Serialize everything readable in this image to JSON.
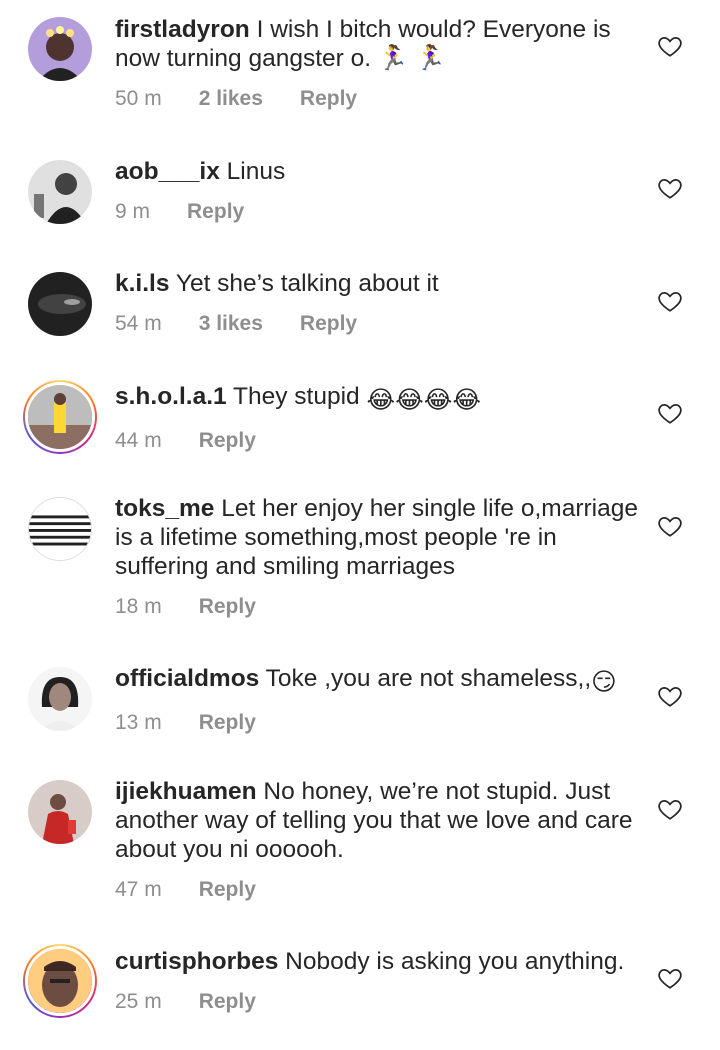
{
  "comments": [
    {
      "username": "firstladyron",
      "text": " I wish I bitch would? Everyone is now turning gangster o. 🏃‍♀️ 🏃‍♀️",
      "time": "50 m",
      "likes": "2 likes",
      "reply": "Reply",
      "avatar": "woman-portrait-flower-crown",
      "story_ring": false
    },
    {
      "username": "aob___ix",
      "text": " Linus",
      "time": "9 m",
      "likes": "",
      "reply": "Reply",
      "avatar": "man-grayscale-cap",
      "story_ring": false
    },
    {
      "username": "k.i.ls",
      "text": " Yet she’s talking about it",
      "time": "54 m",
      "likes": "3 likes",
      "reply": "Reply",
      "avatar": "dark-car-photo",
      "story_ring": false
    },
    {
      "username": "s.h.o.l.a.1",
      "text": " They stupid ",
      "emoji": "😂😂😂😂",
      "time": "44 m",
      "likes": "",
      "reply": "Reply",
      "avatar": "woman-yellow-dress-street",
      "story_ring": true
    },
    {
      "username": "toks_me",
      "text": " Let her enjoy her single life o,marriage is a lifetime something,most people 're in suffering and smiling marriages",
      "time": "18 m",
      "likes": "",
      "reply": "Reply",
      "avatar": "striped-text-logo",
      "story_ring": false
    },
    {
      "username": "officialdmos",
      "text": " Toke ,you are not shameless,,",
      "emoji": "😏",
      "time": "13 m",
      "likes": "",
      "reply": "Reply",
      "avatar": "woman-portrait-smile",
      "story_ring": false
    },
    {
      "username": "ijiekhuamen",
      "text": " No honey, we’re not stupid. Just another way of telling you that we love and care about you ni oooooh.",
      "time": "47 m",
      "likes": "",
      "reply": "Reply",
      "avatar": "woman-red-outfit",
      "story_ring": false
    },
    {
      "username": "curtisphorbes",
      "text": " Nobody is asking you anything.",
      "time": "25 m",
      "likes": "",
      "reply": "Reply",
      "avatar": "man-face-closeup",
      "story_ring": true
    }
  ],
  "icons": {
    "like": "heart-outline-icon"
  },
  "colors": {
    "text": "#262626",
    "meta": "#8e8e8e"
  }
}
